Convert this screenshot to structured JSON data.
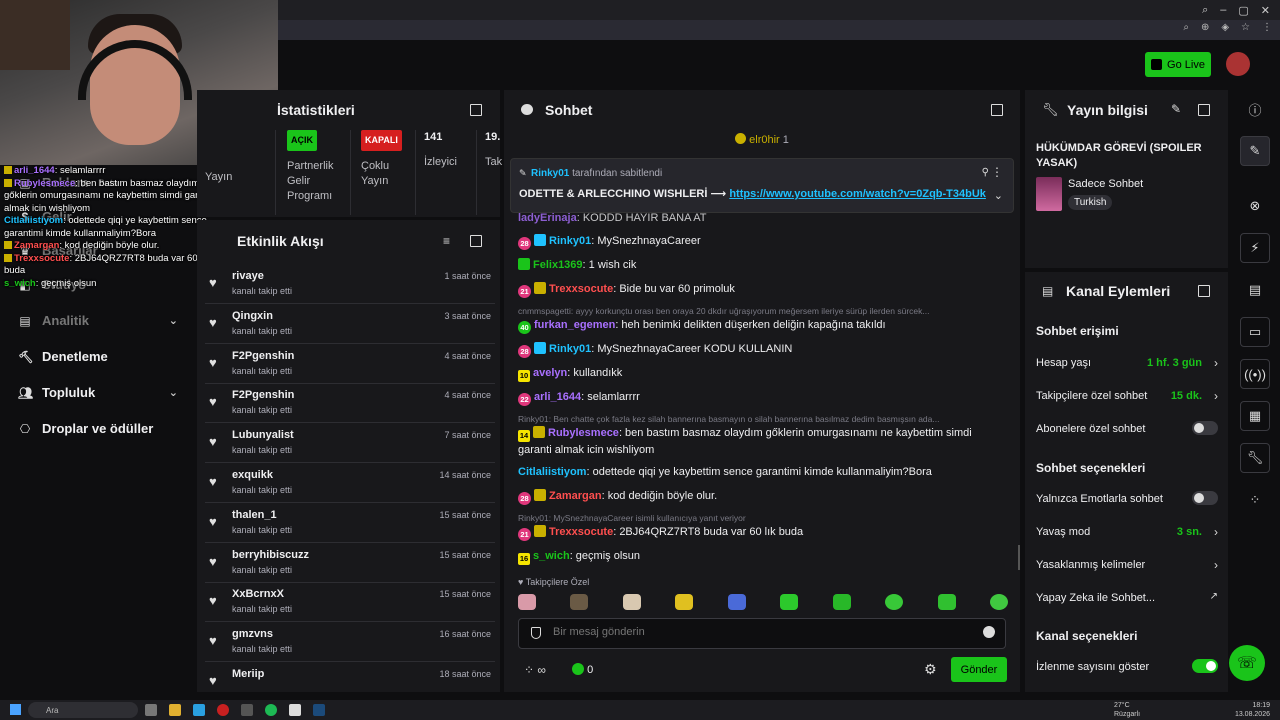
{
  "header": {
    "go_live": "Go Live"
  },
  "overlay_chat": [
    {
      "name": "arli_1644",
      "color": "#a970ff",
      "text": ": selamlarrrr"
    },
    {
      "name": "Rubylesmece",
      "color": "#a970ff",
      "text": ": ben bastım basmaz olaydım gőklerin omurgasınamı ne kaybettim simdi garanti almak icin wishliyom"
    },
    {
      "name": "Citlaliistiyom",
      "color": "#1fc2ff",
      "text": ": odettede qiqi ye kaybettim sence garantimi kimde kullanmaliyim?Bora"
    },
    {
      "name": "Zamargan",
      "color": "#ff4f4f",
      "text": ": kod dediğin böyle olur."
    },
    {
      "name": "Trexxsocute",
      "color": "#ff4f4f",
      "text": ": 2BJ64QRZ7RT8 buda var 60 lık buda"
    },
    {
      "name": "s_wich",
      "color": "#1ac41a",
      "text": ": geçmiş olsun"
    }
  ],
  "sidebar": {
    "dim_items": [
      "Reklam",
      "Beta",
      "Gelir",
      "Başarılar",
      "Stüdyo",
      "Analitik"
    ],
    "items": [
      {
        "label": "Denetleme"
      },
      {
        "label": "Topluluk"
      },
      {
        "label": "Droplar ve ödüller"
      }
    ]
  },
  "stats": {
    "title": "İstatistikleri",
    "col0_label": "Yayın",
    "open_badge": "AÇIK",
    "partner_label": "Partnerlik Gelir Programı",
    "closed_badge": "KAPALI",
    "multi_label": "Çoklu Yayın",
    "viewers_value": "141",
    "viewers_label": "İzleyici",
    "col4_value": "19.",
    "col4_label": "Tak"
  },
  "activity": {
    "title": "Etkinlik Akışı",
    "items": [
      {
        "name": "rivaye",
        "action": "kanalı takip etti",
        "time": "1 saat önce"
      },
      {
        "name": "Qingxin",
        "action": "kanalı takip etti",
        "time": "3 saat önce"
      },
      {
        "name": "F2Pgenshin",
        "action": "kanalı takip etti",
        "time": "4 saat önce"
      },
      {
        "name": "F2Pgenshin",
        "action": "kanalı takip etti",
        "time": "4 saat önce"
      },
      {
        "name": "Lubunyalist",
        "action": "kanalı takip etti",
        "time": "7 saat önce"
      },
      {
        "name": "exquikk",
        "action": "kanalı takip etti",
        "time": "14 saat önce"
      },
      {
        "name": "thalen_1",
        "action": "kanalı takip etti",
        "time": "15 saat önce"
      },
      {
        "name": "berryhibiscuzz",
        "action": "kanalı takip etti",
        "time": "15 saat önce"
      },
      {
        "name": "XxBcrnxX",
        "action": "kanalı takip etti",
        "time": "15 saat önce"
      },
      {
        "name": "gmzvns",
        "action": "kanalı takip etti",
        "time": "16 saat önce"
      },
      {
        "name": "Meriip",
        "action": "",
        "time": "18 saat önce"
      }
    ]
  },
  "chat": {
    "title": "Sohbet",
    "top_user": "elr0hir",
    "top_user_count": "1",
    "pinned_by": "Rinky01",
    "pinned_by_suffix": "tarafından sabitlendi",
    "pinned_text": "ODETTE & ARLECCHINO WISHLERİ ⟶",
    "pinned_link": "https://www.youtube.com/watch?v=0Zqb-T34bUk",
    "messages": [
      {
        "badge": "",
        "name": "ladyErinaja",
        "color": "#a970ff",
        "text": ": KODDD HAYIR BANA AT"
      },
      {
        "badge": "28",
        "name": "Rinky01",
        "color": "#1fc2ff",
        "text": ": MySnezhnayaCareer"
      },
      {
        "badge": "",
        "name": "Felix1369",
        "color": "#1ac41a",
        "text": ": 1 wish cik"
      },
      {
        "badge": "21",
        "name": "Trexxsocute",
        "color": "#ff4f4f",
        "text": ": Bide bu var 60 primoluk"
      },
      {
        "badge": "40",
        "name": "furkan_egemen",
        "color": "#a970ff",
        "text": ": heh benimki delikten düşerken deliğin kapağına takıldı"
      },
      {
        "badge": "28",
        "name": "Rinky01",
        "color": "#1fc2ff",
        "text": ": MySnezhnayaCareer KODU KULLANIN"
      },
      {
        "badge": "10",
        "name": "avelyn",
        "color": "#a970ff",
        "text": ": kullandıkk"
      },
      {
        "badge": "22",
        "name": "arli_1644",
        "color": "#a970ff",
        "text": ": selamlarrrr"
      },
      {
        "badge": "14",
        "name": "Rubylesmece",
        "color": "#a970ff",
        "text": ": ben bastım basmaz olaydım gőklerin omurgasınamı ne kaybettim simdi garanti almak icin wishliyom"
      },
      {
        "badge": "",
        "name": "Citlaliistiyom",
        "color": "#1fc2ff",
        "text": ": odettede qiqi ye kaybettim sence garantimi kimde kullanmaliyim?Bora"
      },
      {
        "badge": "28",
        "name": "Zamargan",
        "color": "#ff4f4f",
        "text": ": kod dediğin böyle olur."
      },
      {
        "badge": "21",
        "name": "Trexxsocute",
        "color": "#ff4f4f",
        "text": ": 2BJ64QRZ7RT8 buda var 60 lık buda"
      },
      {
        "badge": "16",
        "name": "s_wich",
        "color": "#1ac41a",
        "text": ": geçmiş olsun"
      }
    ],
    "reply_1": "cnmmspagetti: ayyy korkunçtu orası ben oraya 20 dkdır uğraşıyorum meğersem ileriye sürüp ilerden sürcek...",
    "reply_2": "Rinky01: Ben chatte çok fazla kez silah bannerına basmayın o silah bannerına basılmaz dedim basmışsın ada...",
    "reply_3": "Rinky01: MySnezhnayaCareer isimli kullanıcıya yanıt veriyor",
    "followers_only": "Takipçilere Özel",
    "input_placeholder": "Bir mesaj gönderin",
    "points_value": "∞",
    "kick_points": "0",
    "send_label": "Gönder"
  },
  "stream_info": {
    "title": "Yayın bilgisi",
    "stream_title": "HÜKÜMDAR GÖREVİ (SPOILER YASAK)",
    "category": "Sadece Sohbet",
    "tag": "Turkish"
  },
  "channel_actions": {
    "title": "Kanal Eylemleri",
    "chat_access": "Sohbet erişimi",
    "account_age": "Hesap yaşı",
    "account_age_value": "1 hf. 3 gün",
    "followers_chat": "Takipçilere özel sohbet",
    "followers_chat_value": "15 dk.",
    "subs_chat": "Abonelere özel sohbet",
    "chat_options": "Sohbet seçenekleri",
    "emote_only": "Yalnızca Emotlarla sohbet",
    "slow_mode": "Yavaş mod",
    "slow_mode_value": "3 sn.",
    "banned_words": "Yasaklanmış kelimeler",
    "ai_chat": "Yapay Zeka ile Sohbet...",
    "channel_options": "Kanal seçenekleri",
    "show_views": "İzlenme sayısını göster"
  },
  "taskbar": {
    "search": "Ara",
    "weather_temp": "27°C",
    "weather_desc": "Rüzgarlı",
    "time": "18:19",
    "date": "13.08.2026"
  }
}
